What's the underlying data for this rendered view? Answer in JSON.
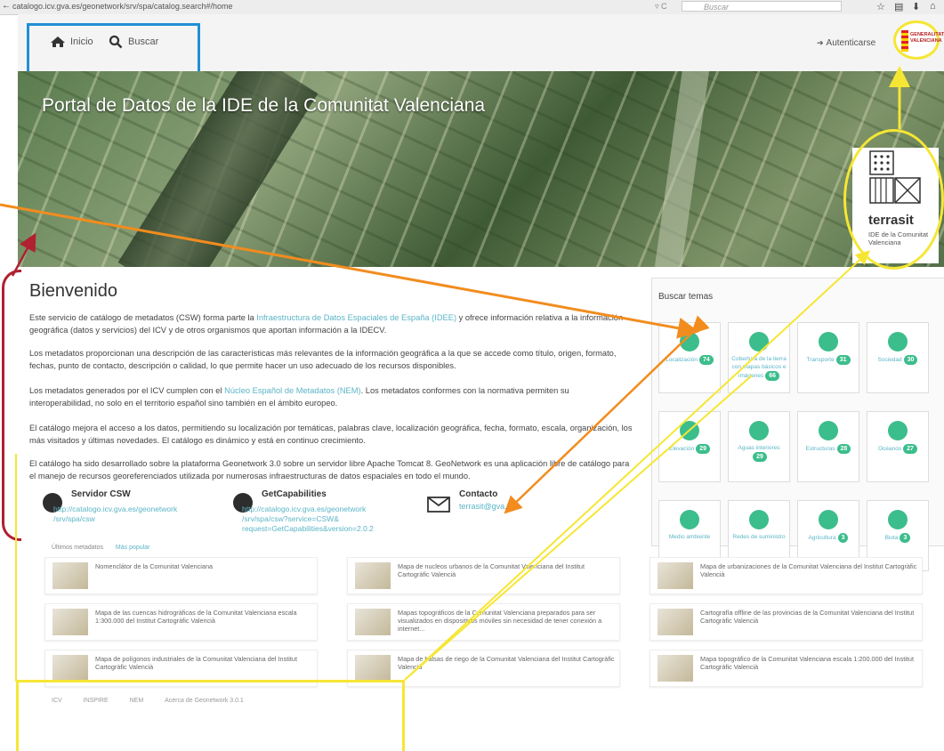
{
  "browser": {
    "url": "catalogo.icv.gva.es/geonetwork/srv/spa/catalog.search#/home",
    "search_placeholder": "Buscar"
  },
  "nav": {
    "home_label": "Inicio",
    "search_label": "Buscar",
    "login_label": "Autenticarse",
    "logo_text": "GENERALITAT VALENCIANA"
  },
  "hero": {
    "title": "Portal de Datos de la IDE de la Comunitat Valenciana",
    "terrasit_name": "terrasit",
    "terrasit_sub": "IDE de la Comunitat Valenciana"
  },
  "welcome": {
    "title": "Bienvenido",
    "p1_a": "Este servicio de catálogo de metadatos (CSW) forma parte la ",
    "p1_link": "Infraestructura de Datos Espaciales de España (IDEE)",
    "p1_b": " y ofrece información relativa a la información geográfica (datos y servicios) del ICV y de otros organismos que aportan información a la IDECV.",
    "p2": "Los metadatos proporcionan una descripción de las características más relevantes de la información geográfica a la que se accede como título, origen, formato, fechas, punto de contacto, descripción o calidad, lo que permite hacer un uso adecuado de los recursos disponibles.",
    "p3_a": "Los metadatos generados por el ICV cumplen con el ",
    "p3_link": "Núcleo Español de Metadatos (NEM)",
    "p3_b": ". Los metadatos conformes con la normativa permiten su interoperabilidad, no solo en el territorio español sino también en el ámbito europeo.",
    "p4": "El catálogo mejora el acceso a los datos, permitiendo su localización por temáticas, palabras clave, localización geográfica, fecha, formato, escala, organización, los más visitados y últimas novedades. El catálogo es dinámico y está en continuo crecimiento.",
    "p5": "El catálogo ha sido desarrollado sobre la plataforma Geonetwork 3.0 sobre un servidor libre Apache Tomcat 8. GeoNetwork es una aplicación libre de catálogo para el manejo de recursos georeferenciados utilizada por numerosas infraestructuras de datos espaciales en todo el mundo."
  },
  "services": {
    "csw_title": "Servidor CSW",
    "csw_link": "http://catalogo.icv.gva.es/geonetwork /srv/spa/csw",
    "gc_title": "GetCapabilities",
    "gc_link": "http://catalogo.icv.gva.es/geonetwork /srv/spa/csw?service=CSW& request=GetCapabilities&version=2.0.2",
    "contact_title": "Contacto",
    "contact_link": "terrasit@gva.es"
  },
  "topics": {
    "title": "Buscar temas",
    "items": [
      {
        "label": "Localización",
        "count": "74",
        "icon": "map-marker-icon"
      },
      {
        "label": "Cobertura de la tierra con mapas básicos e imágenes",
        "count": "66",
        "icon": "globe-icon"
      },
      {
        "label": "Transporte",
        "count": "31",
        "icon": "truck-icon"
      },
      {
        "label": "Sociedad",
        "count": "30",
        "icon": "comments-icon"
      },
      {
        "label": "Elevación",
        "count": "29",
        "icon": "flag-icon"
      },
      {
        "label": "Aguas interiores",
        "count": "29",
        "icon": "drop-icon"
      },
      {
        "label": "Estructuras",
        "count": "28",
        "icon": "building-icon"
      },
      {
        "label": "Océanos",
        "count": "27",
        "icon": "anchor-icon"
      },
      {
        "label": "Medio ambiente",
        "count": "",
        "icon": "tree-icon"
      },
      {
        "label": "Redes de suministro",
        "count": "",
        "icon": "phone-icon"
      },
      {
        "label": "Agricultura",
        "count": "3",
        "icon": "leaf-outline-icon"
      },
      {
        "label": "Biota",
        "count": "3",
        "icon": "leaf-icon"
      }
    ]
  },
  "records": {
    "tab_latest": "Últimos metadatos",
    "tab_popular": "Más popular",
    "items": [
      "Nomenclátor de la Comunitat Valenciana",
      "Mapa de nucleos urbanos de la Comunitat Valenciana del Institut Cartogràfic Valencià",
      "Mapa de urbanizaciones de la Comunitat Valenciana del Institut Cartogràfic Valencià",
      "Mapa de las cuencas hidrográficas de la Comunitat Valenciana escala 1:300.000 del Institut Cartogràfic Valencià",
      "Mapas topográficos de la Comunitat Valenciana preparados para ser visualizados en dispositivos móviles sin necesidad de tener conexión a internet...",
      "Cartografía offline de las provincias de la Comunitat Valenciana del Institut Cartogràfic Valencià",
      "Mapa de polígonos industriales de la Comunitat Valenciana del Institut Cartogràfic Valencià",
      "Mapa de balsas de riego de la Comunitat Valenciana del Institut Cartogràfic Valencià",
      "Mapa topográfico de la Comunitat Valenciana escala 1:200.000 del Institut Cartogràfic Valencià"
    ]
  },
  "footer": {
    "links": [
      "ICV",
      "INSPIRE",
      "NEM",
      "Acerca de Geonetwork 3.0.1"
    ]
  },
  "colors": {
    "accent": "#3cbd8c",
    "link": "#5bb5c7",
    "annotation_blue": "#1e8fd6",
    "annotation_yellow": "#f6e634",
    "annotation_orange": "#f28c1e",
    "annotation_red": "#b02030"
  }
}
